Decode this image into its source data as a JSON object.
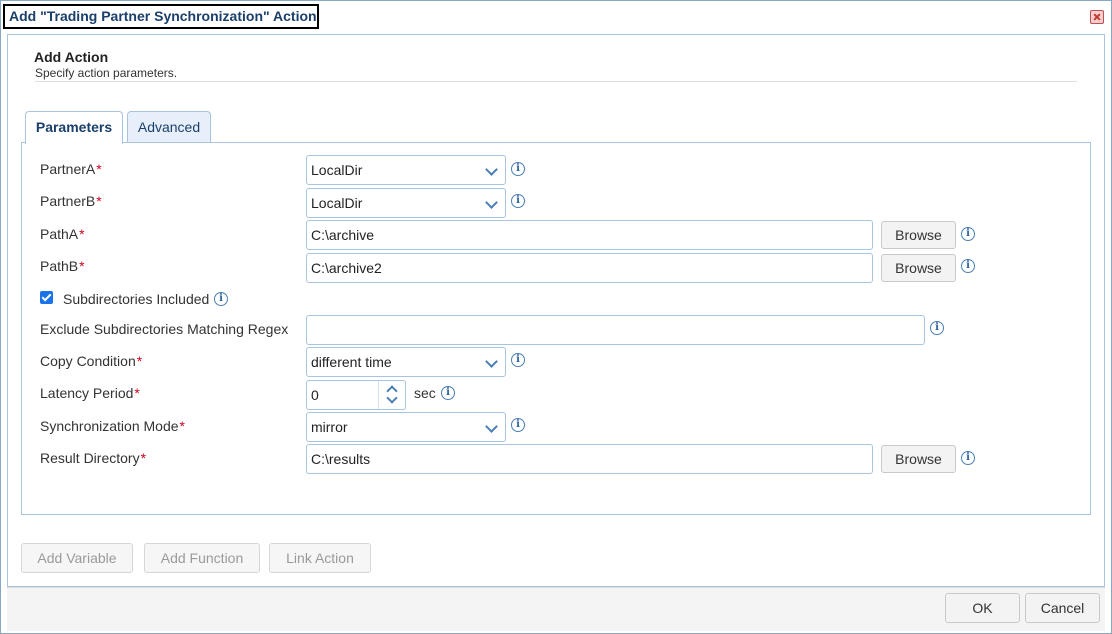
{
  "window": {
    "title": "Add \"Trading Partner Synchronization\" Action"
  },
  "header": {
    "title": "Add Action",
    "subtitle": "Specify action parameters."
  },
  "tabs": [
    {
      "label": "Parameters",
      "active": true
    },
    {
      "label": "Advanced",
      "active": false
    }
  ],
  "form": {
    "partnerA": {
      "label": "PartnerA",
      "value": "LocalDir"
    },
    "partnerB": {
      "label": "PartnerB",
      "value": "LocalDir"
    },
    "pathA": {
      "label": "PathA",
      "value": "C:\\archive",
      "browse": "Browse"
    },
    "pathB": {
      "label": "PathB",
      "value": "C:\\archive2",
      "browse": "Browse"
    },
    "subdirs": {
      "label": "Subdirectories Included",
      "checked": true
    },
    "excludeRegex": {
      "label": "Exclude Subdirectories Matching Regex",
      "value": ""
    },
    "copyCondition": {
      "label": "Copy Condition",
      "value": "different time"
    },
    "latency": {
      "label": "Latency Period",
      "value": "0",
      "unit": "sec"
    },
    "syncMode": {
      "label": "Synchronization Mode",
      "value": "mirror"
    },
    "resultDir": {
      "label": "Result Directory",
      "value": "C:\\results",
      "browse": "Browse"
    },
    "required_mark": "*",
    "info_glyph": "i"
  },
  "actions": {
    "addVariable": "Add Variable",
    "addFunction": "Add Function",
    "linkAction": "Link Action"
  },
  "footer": {
    "ok": "OK",
    "cancel": "Cancel"
  },
  "colors": {
    "accent": "#1a3f6b",
    "border": "#a9c4e0",
    "required": "#d0021b",
    "checkbox": "#1a73e8"
  }
}
